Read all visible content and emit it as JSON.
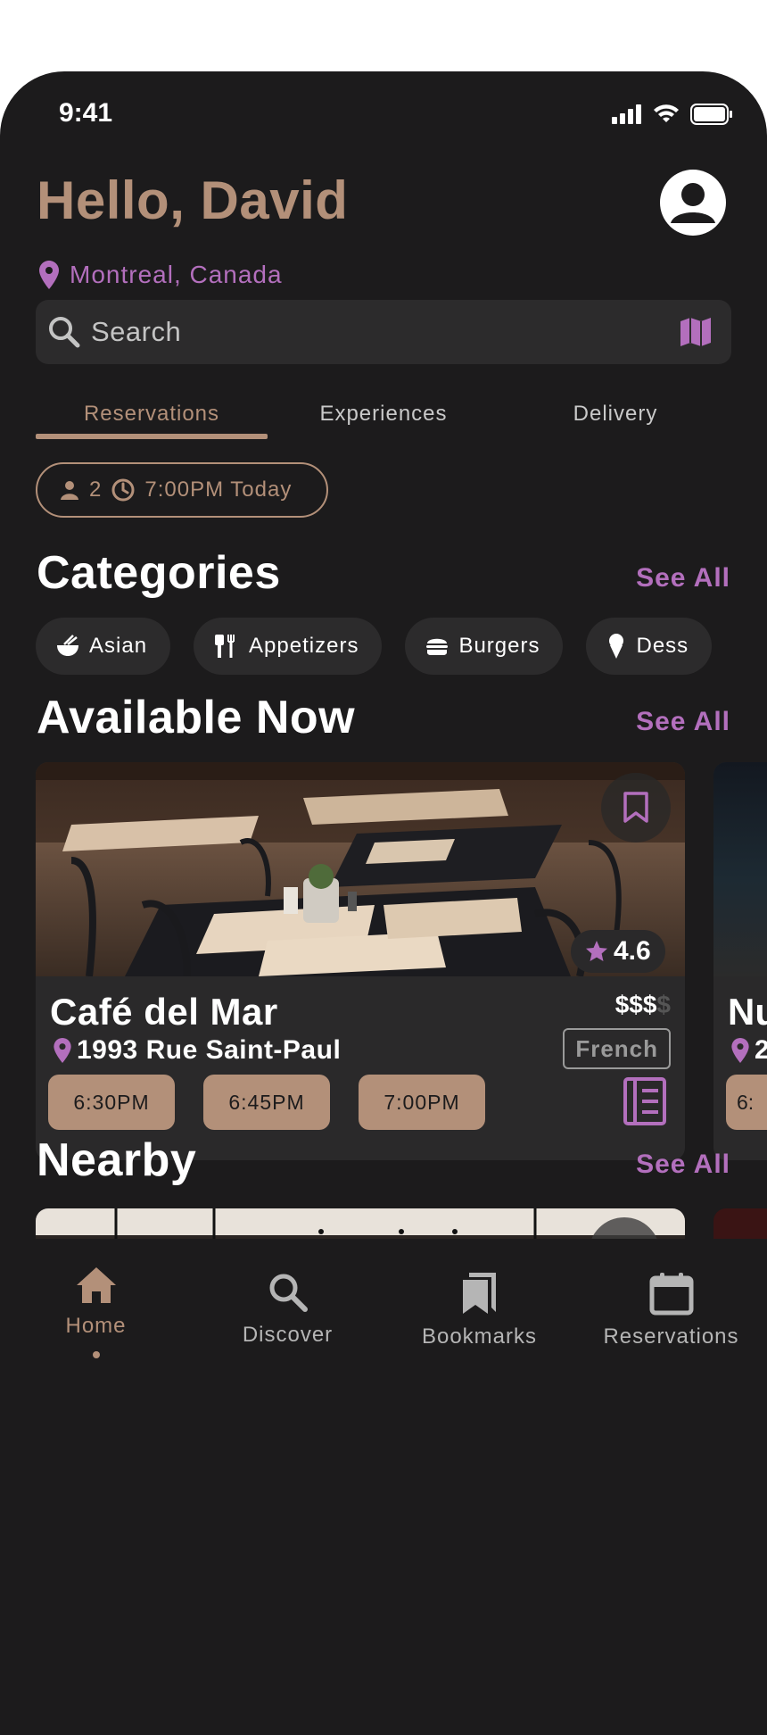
{
  "status": {
    "time": "9:41"
  },
  "header": {
    "greeting": "Hello, David",
    "location": "Montreal, Canada"
  },
  "search": {
    "placeholder": "Search"
  },
  "tabs": [
    {
      "label": "Reservations",
      "active": true
    },
    {
      "label": "Experiences",
      "active": false
    },
    {
      "label": "Delivery",
      "active": false
    }
  ],
  "filter": {
    "party_size": "2",
    "time": "7:00PM Today"
  },
  "categories": {
    "title": "Categories",
    "see_all": "See All",
    "items": [
      {
        "label": "Asian",
        "icon": "bowl-icon"
      },
      {
        "label": "Appetizers",
        "icon": "utensils-icon"
      },
      {
        "label": "Burgers",
        "icon": "burger-icon"
      },
      {
        "label": "Dess",
        "icon": "ice-cream-icon"
      }
    ]
  },
  "available_now": {
    "title": "Available Now",
    "see_all": "See All",
    "cards": [
      {
        "name": "Café del Mar",
        "address": "1993 Rue Saint-Paul",
        "price_active": "$$$",
        "price_inactive": "$",
        "rating": "4.6",
        "cuisine": "French",
        "times": [
          "6:30PM",
          "6:45PM",
          "7:00PM"
        ]
      },
      {
        "name": "Nu",
        "address": "2",
        "times": [
          "6:"
        ]
      }
    ]
  },
  "nearby": {
    "title": "Nearby",
    "see_all": "See All"
  },
  "bottom_nav": {
    "items": [
      {
        "label": "Home",
        "icon": "home-icon",
        "active": true
      },
      {
        "label": "Discover",
        "icon": "search-icon",
        "active": false
      },
      {
        "label": "Bookmarks",
        "icon": "bookmarks-icon",
        "active": false
      },
      {
        "label": "Reservations",
        "icon": "calendar-icon",
        "active": false
      }
    ]
  },
  "colors": {
    "background": "#1c1b1c",
    "accent_tan": "#b39079",
    "accent_purple": "#b36fbd",
    "surface": "#2c2b2c"
  }
}
